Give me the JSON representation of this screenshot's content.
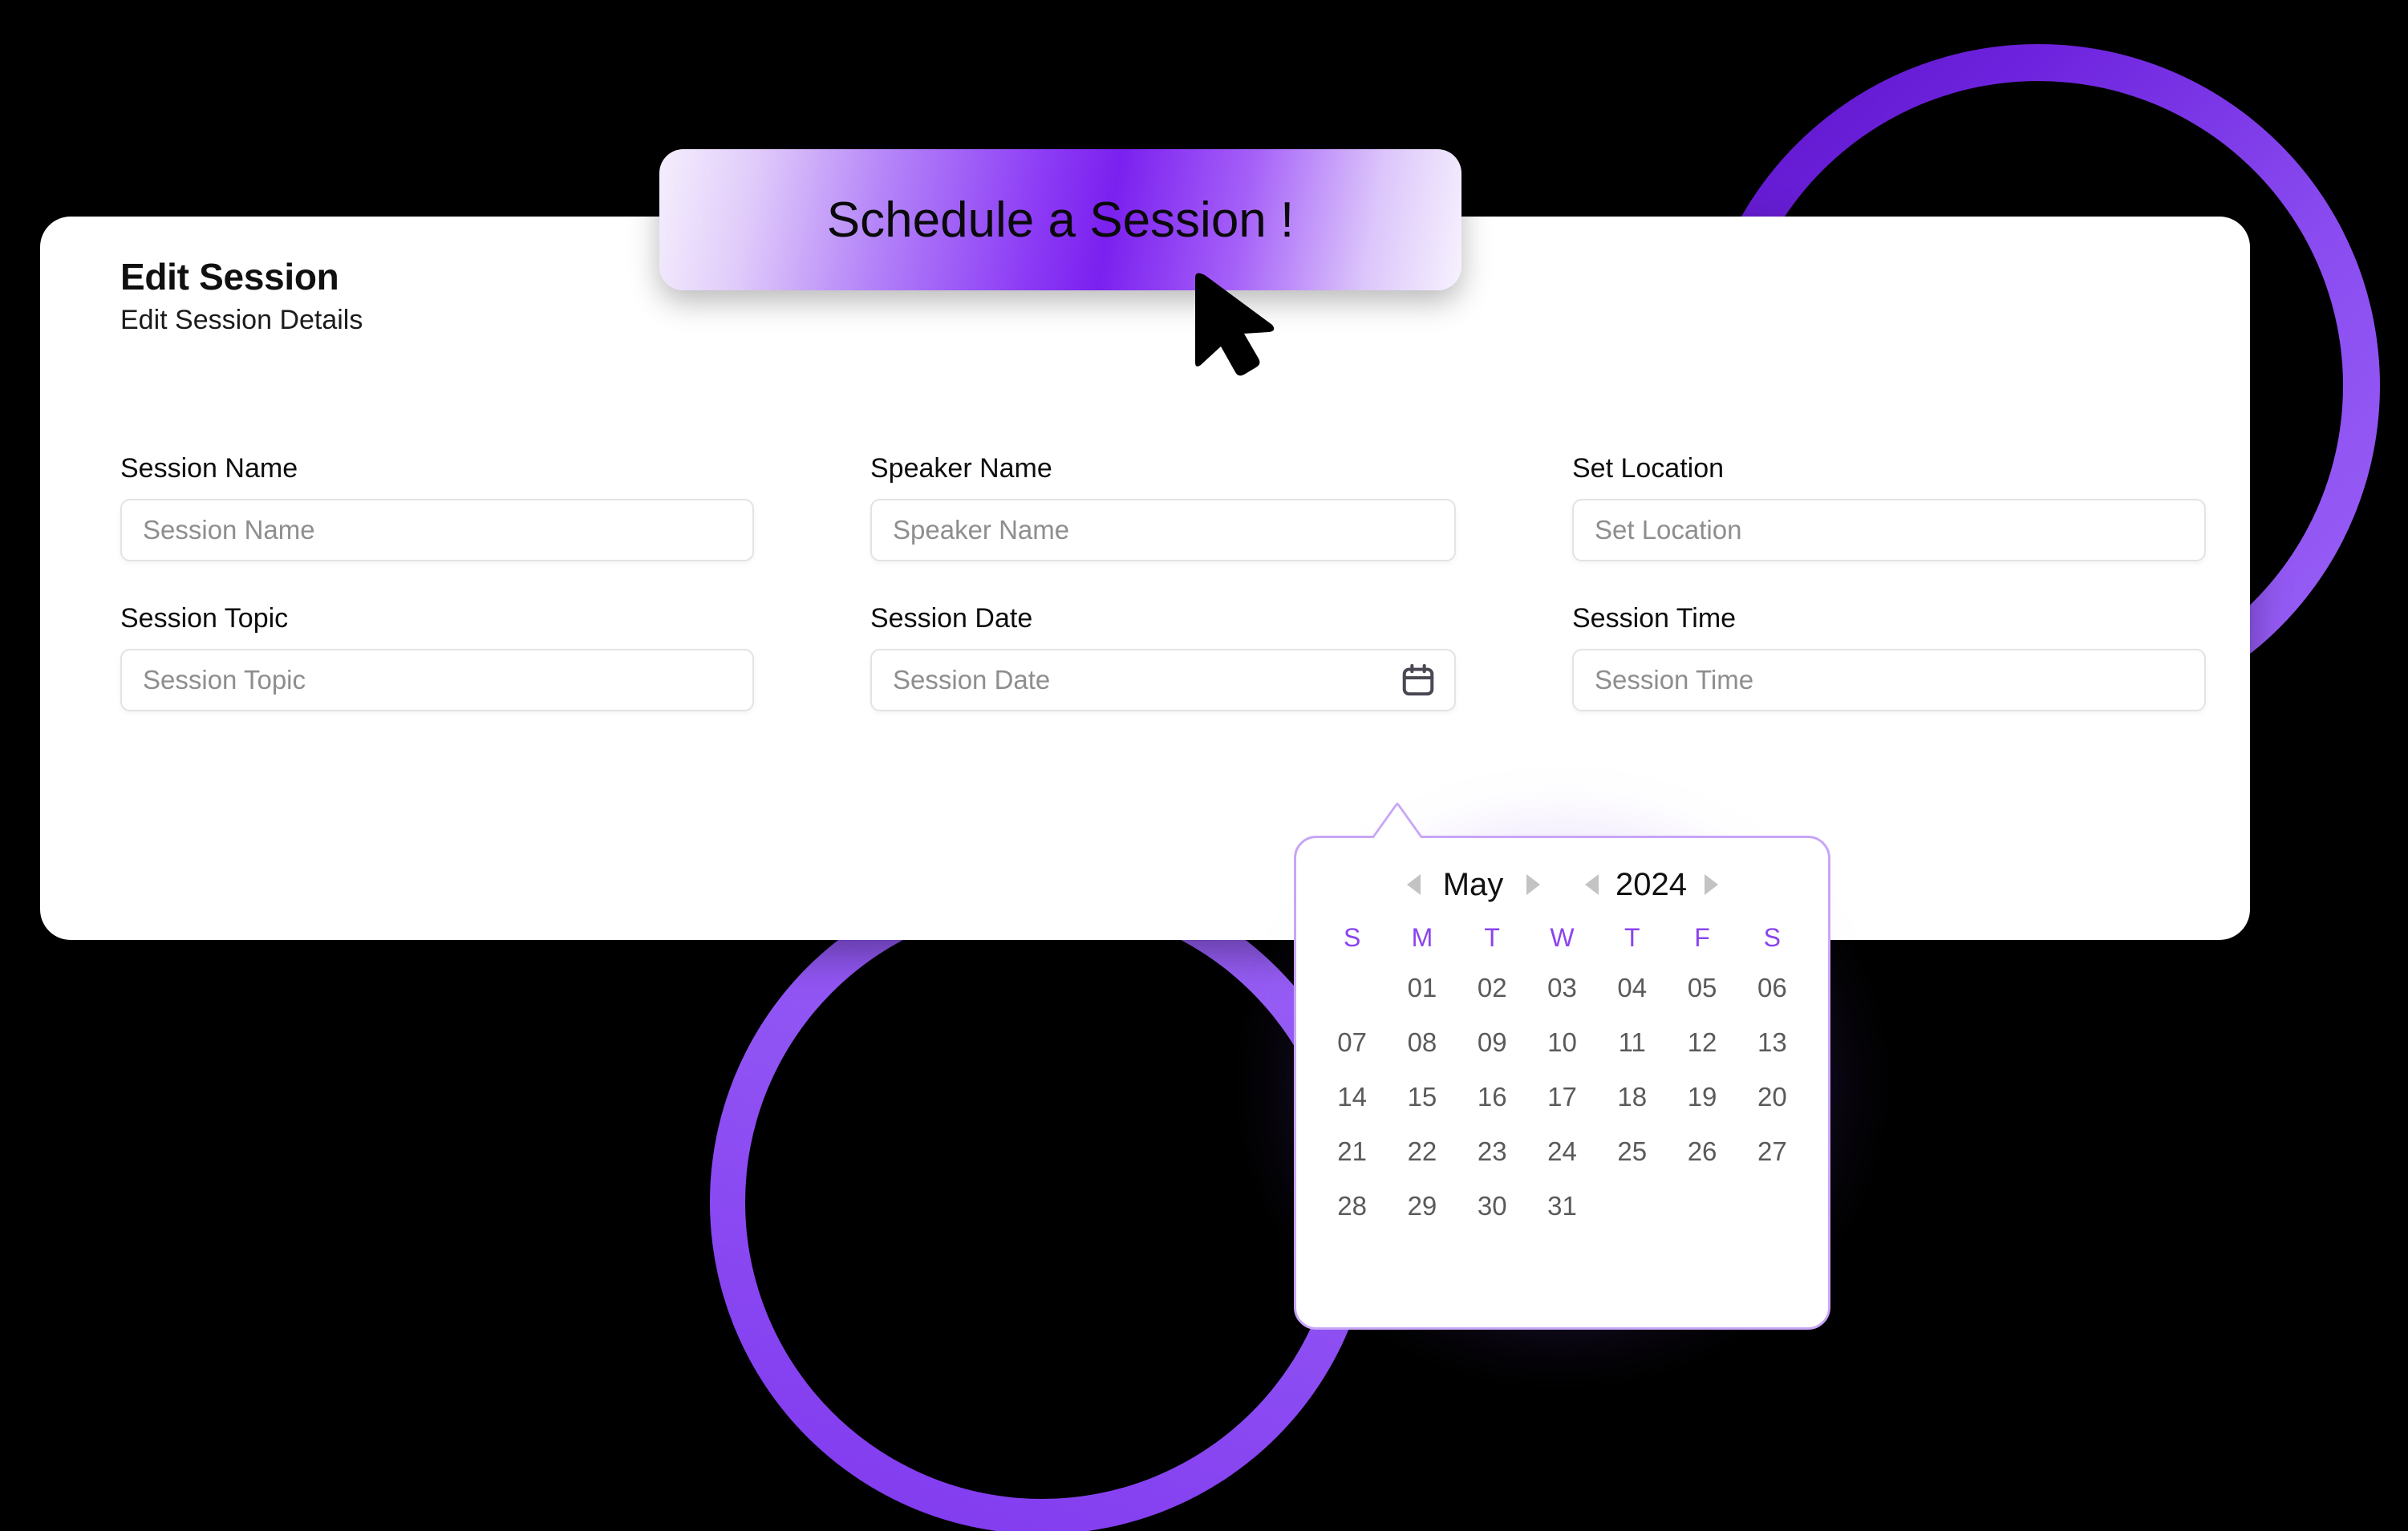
{
  "badge": {
    "label": "Schedule a Session !"
  },
  "card": {
    "title": "Edit Session",
    "subtitle": "Edit Session Details",
    "fields": [
      {
        "label": "Session Name",
        "placeholder": "Session Name",
        "value": "",
        "icon": null
      },
      {
        "label": "Speaker Name",
        "placeholder": "Speaker Name",
        "value": "",
        "icon": null
      },
      {
        "label": "Set Location",
        "placeholder": "Set Location",
        "value": "",
        "icon": null
      },
      {
        "label": "Session Topic",
        "placeholder": "Session Topic",
        "value": "",
        "icon": null
      },
      {
        "label": "Session Date",
        "placeholder": "Session Date",
        "value": "",
        "icon": "calendar-icon"
      },
      {
        "label": "Session Time",
        "placeholder": "Session Time",
        "value": "",
        "icon": null
      }
    ]
  },
  "date_picker": {
    "month": "May",
    "year": "2024",
    "prev_month_icon": "chevron-left-icon",
    "next_month_icon": "chevron-right-icon",
    "prev_year_icon": "chevron-left-icon",
    "next_year_icon": "chevron-right-icon",
    "weekdays": [
      "S",
      "M",
      "T",
      "W",
      "T",
      "F",
      "S"
    ],
    "weeks": [
      [
        "",
        "01",
        "02",
        "03",
        "04",
        "05",
        "06"
      ],
      [
        "07",
        "08",
        "09",
        "10",
        "11",
        "12",
        "13"
      ],
      [
        "14",
        "15",
        "16",
        "17",
        "18",
        "19",
        "20"
      ],
      [
        "21",
        "22",
        "23",
        "24",
        "25",
        "26",
        "27"
      ],
      [
        "28",
        "29",
        "30",
        "31",
        "",
        "",
        ""
      ]
    ]
  },
  "decor": {
    "ring_top_right_color": "#7b2ae8",
    "ring_bottom_left_color": "#8f52f3",
    "accent_purple": "#8b44ee",
    "background": "#000000"
  },
  "cursor": {
    "icon": "mouse-pointer-icon"
  }
}
